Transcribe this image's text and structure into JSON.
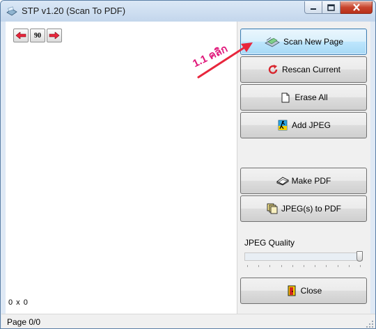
{
  "window": {
    "title": "STP v1.20 (Scan To PDF)"
  },
  "toolbar": {
    "rotate_left_icon": "red-left-arrow-icon",
    "rotate_label": "90",
    "rotate_right_icon": "red-right-arrow-icon"
  },
  "scan_area": {
    "dimensions_text": "0 x 0"
  },
  "buttons": {
    "scan_new_page": "Scan New Page",
    "rescan_current": "Rescan Current",
    "erase_all": "Erase All",
    "add_jpeg": "Add JPEG",
    "make_pdf": "Make PDF",
    "jpegs_to_pdf": "JPEG(s) to PDF",
    "close": "Close"
  },
  "jpeg_quality": {
    "label": "JPEG Quality",
    "value_fraction": 1.0
  },
  "status": {
    "page": "Page 0/0"
  },
  "annotation": {
    "text": "1.1 คลิก",
    "color": "#e0177a"
  },
  "colors": {
    "focused_button_border": "#3c7fb1",
    "close_button": "#c8452e",
    "arrow": "#e8263c"
  }
}
